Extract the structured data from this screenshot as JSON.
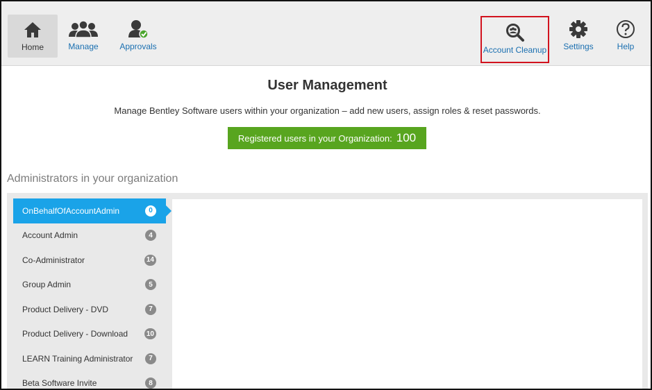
{
  "toolbar": {
    "home": {
      "label": "Home",
      "icon": "home-icon"
    },
    "manage": {
      "label": "Manage",
      "icon": "users-icon"
    },
    "approvals": {
      "label": "Approvals",
      "icon": "user-check-icon"
    },
    "account_cleanup": {
      "label": "Account Cleanup",
      "icon": "search-users-icon"
    },
    "settings": {
      "label": "Settings",
      "icon": "gear-icon"
    },
    "help": {
      "label": "Help",
      "icon": "help-icon"
    }
  },
  "main": {
    "title": "User Management",
    "subtitle": "Manage Bentley Software users within your organization – add new users, assign roles & reset passwords.",
    "registered_label": "Registered users in your Organization:",
    "registered_count": "100",
    "admins_heading": "Administrators in your organization"
  },
  "admin_roles": [
    {
      "name": "OnBehalfOfAccountAdmin",
      "count": "0"
    },
    {
      "name": "Account Admin",
      "count": "4"
    },
    {
      "name": "Co-Administrator",
      "count": "14"
    },
    {
      "name": "Group Admin",
      "count": "5"
    },
    {
      "name": "Product Delivery - DVD",
      "count": "7"
    },
    {
      "name": "Product Delivery - Download",
      "count": "10"
    },
    {
      "name": "LEARN Training Administrator",
      "count": "7"
    },
    {
      "name": "Beta Software Invite",
      "count": "8"
    }
  ],
  "colors": {
    "accent_blue": "#1aa3e8",
    "badge_green": "#58a51f",
    "highlight_red": "#d2121e",
    "link_blue": "#1a6fb0"
  }
}
